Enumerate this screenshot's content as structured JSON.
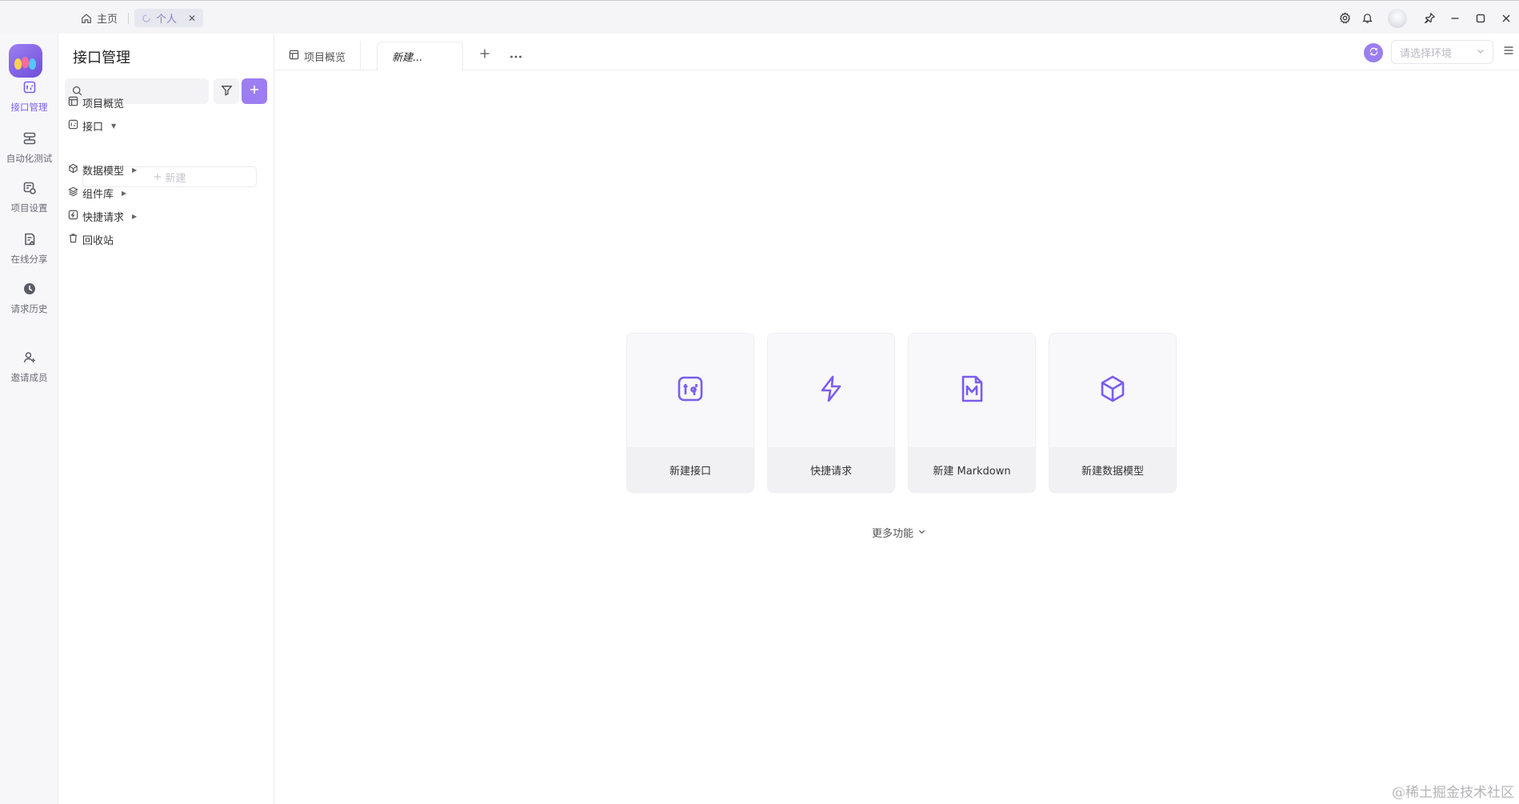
{
  "titlebar": {
    "home_label": "主页",
    "personal_label": "个人"
  },
  "rail": {
    "items": [
      {
        "label": "接口管理",
        "icon": "api-icon",
        "active": true
      },
      {
        "label": "自动化测试",
        "icon": "automation-icon",
        "active": false
      },
      {
        "label": "项目设置",
        "icon": "project-settings-icon",
        "active": false
      },
      {
        "label": "在线分享",
        "icon": "share-doc-icon",
        "active": false
      },
      {
        "label": "请求历史",
        "icon": "history-icon",
        "active": false
      },
      {
        "label": "邀请成员",
        "icon": "invite-user-icon",
        "active": false
      }
    ]
  },
  "sidebar": {
    "title": "接口管理",
    "search_placeholder": "",
    "tree": [
      {
        "label": "项目概览",
        "icon": "overview-icon",
        "caret": false
      },
      {
        "label": "接口",
        "icon": "api-icon",
        "caret": true
      },
      {
        "label": "数据模型",
        "icon": "cube-icon",
        "caret": true
      },
      {
        "label": "组件库",
        "icon": "layers-icon",
        "caret": true
      },
      {
        "label": "快捷请求",
        "icon": "lightning-icon",
        "caret": true
      },
      {
        "label": "回收站",
        "icon": "trash-icon",
        "caret": false
      }
    ],
    "new_label": "新建"
  },
  "main": {
    "tabs": [
      {
        "label": "项目概览"
      },
      {
        "label": "新建..."
      }
    ],
    "env_placeholder": "请选择环境",
    "cards": [
      {
        "label": "新建接口",
        "icon": "api-icon"
      },
      {
        "label": "快捷请求",
        "icon": "lightning-icon"
      },
      {
        "label": "新建 Markdown",
        "icon": "markdown-icon"
      },
      {
        "label": "新建数据模型",
        "icon": "cube-icon"
      }
    ],
    "more_label": "更多功能"
  },
  "watermark": "@稀土掘金技术社区",
  "colors": {
    "accent": "#7b5cf0",
    "accent_light": "#9c7ef2",
    "rail_bg": "#f7f7fa",
    "card_bg": "#f6f6f8"
  }
}
